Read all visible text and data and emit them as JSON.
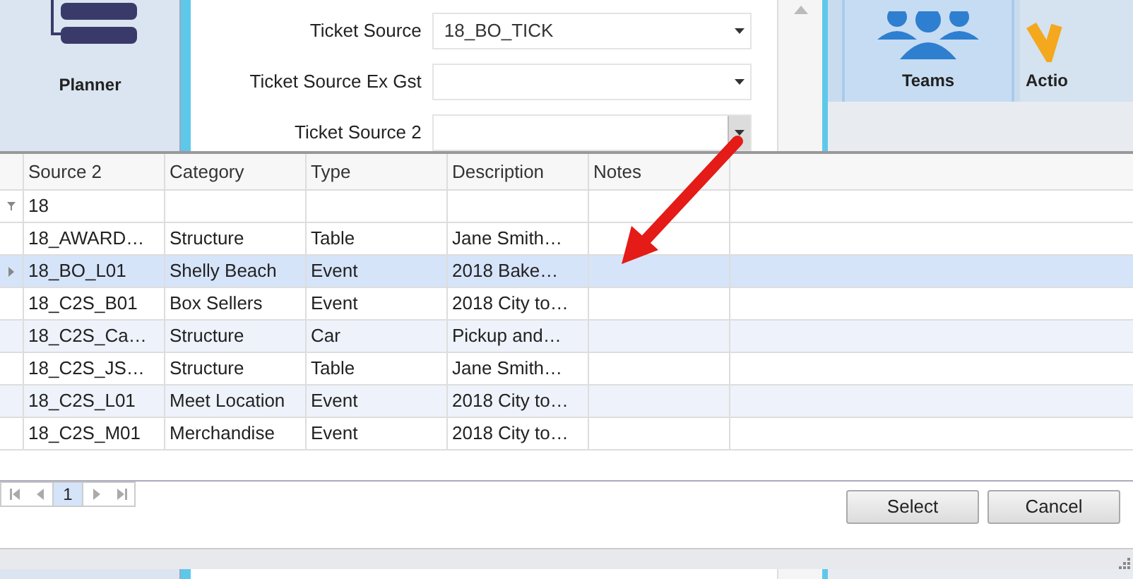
{
  "sidebar": {
    "label": "Planner"
  },
  "form": {
    "fields": [
      {
        "label": "Ticket Source",
        "value": "18_BO_TICK",
        "focused": false
      },
      {
        "label": "Ticket Source Ex Gst",
        "focused": false
      },
      {
        "label": "Ticket Source 2",
        "focused": true
      }
    ]
  },
  "tiles": [
    {
      "label": "Teams",
      "kind": "teams"
    },
    {
      "label": "Actio",
      "kind": "action"
    }
  ],
  "grid": {
    "columns": [
      "Source 2",
      "Category",
      "Type",
      "Description",
      "Notes"
    ],
    "filter": "18",
    "rows": [
      {
        "cells": [
          "18_AWARD…",
          "Structure",
          "Table",
          "Jane Smith…",
          ""
        ],
        "selected": false
      },
      {
        "cells": [
          "18_BO_L01",
          "Shelly Beach",
          "Event",
          "2018 Bake…",
          ""
        ],
        "selected": true
      },
      {
        "cells": [
          "18_C2S_B01",
          "Box Sellers",
          "Event",
          "2018 City to…",
          ""
        ],
        "selected": false
      },
      {
        "cells": [
          "18_C2S_Ca…",
          "Structure",
          "Car",
          "Pickup and…",
          ""
        ],
        "selected": false
      },
      {
        "cells": [
          "18_C2S_JS…",
          "Structure",
          "Table",
          "Jane Smith…",
          ""
        ],
        "selected": false
      },
      {
        "cells": [
          "18_C2S_L01",
          "Meet Location",
          "Event",
          "2018 City to…",
          ""
        ],
        "selected": false
      },
      {
        "cells": [
          "18_C2S_M01",
          "Merchandise",
          "Event",
          "2018 City to…",
          ""
        ],
        "selected": false
      }
    ]
  },
  "pager": {
    "pages": [
      {
        "label": "1",
        "selected": true
      }
    ]
  },
  "buttons": [
    "Select",
    "Cancel"
  ]
}
